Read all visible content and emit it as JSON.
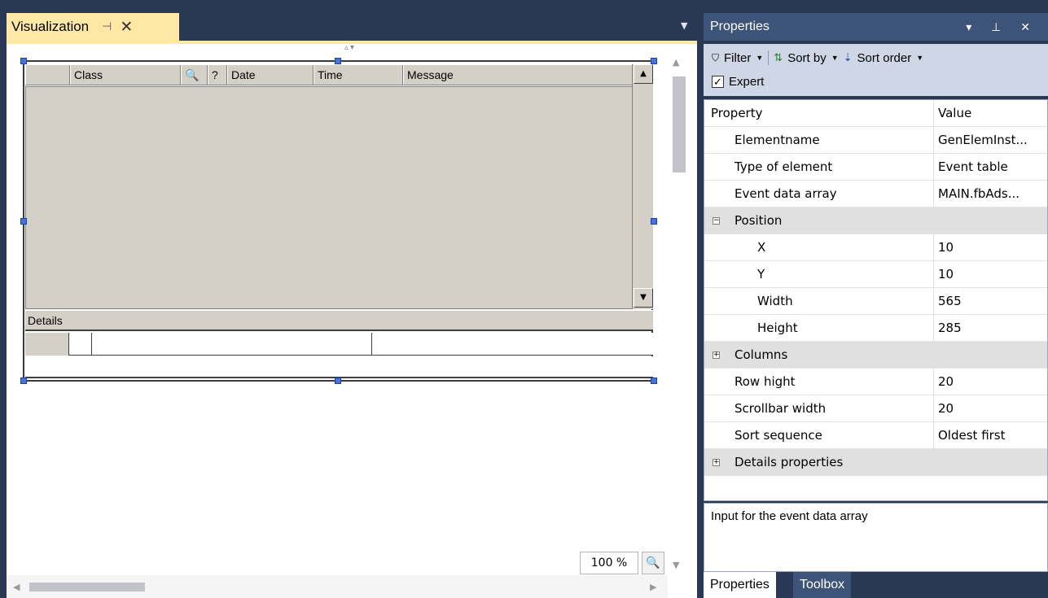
{
  "document": {
    "tab_title": "Visualization",
    "pin_glyph": "⊣",
    "close_glyph": "✕",
    "dropdown_glyph": "▼",
    "event_table": {
      "columns": [
        "",
        "Class",
        "",
        "?",
        "Date",
        "Time",
        "Message"
      ],
      "details_label": "Details",
      "scroll_up": "▲",
      "scroll_down": "▼"
    },
    "zoom": "100 %"
  },
  "properties": {
    "title": "Properties",
    "title_controls": "▾ ⊥ ✕",
    "toolbar": {
      "filter": "Filter",
      "sort_by": "Sort by",
      "sort_order": "Sort order",
      "expert": "Expert",
      "expert_checked": true
    },
    "header": {
      "property": "Property",
      "value": "Value"
    },
    "rows": [
      {
        "name": "Elementname",
        "value": "GenElemInst..."
      },
      {
        "name": "Type of element",
        "value": "Event table"
      },
      {
        "name": "Event data array",
        "value": "MAIN.fbAds..."
      },
      {
        "name": "Position",
        "value": "",
        "category": true,
        "expanded": true
      },
      {
        "name": "X",
        "value": "10"
      },
      {
        "name": "Y",
        "value": "10"
      },
      {
        "name": "Width",
        "value": "565"
      },
      {
        "name": "Height",
        "value": "285"
      },
      {
        "name": "Columns",
        "value": "",
        "category": true,
        "expanded": false
      },
      {
        "name": "Row hight",
        "value": "20"
      },
      {
        "name": "Scrollbar width",
        "value": "20"
      },
      {
        "name": "Sort sequence",
        "value": "Oldest first"
      },
      {
        "name": "Details properties",
        "value": "",
        "category": true,
        "expanded": false
      }
    ],
    "description": "Input for the event data array",
    "tabs": {
      "active": "Properties",
      "inactive": "Toolbox"
    }
  }
}
